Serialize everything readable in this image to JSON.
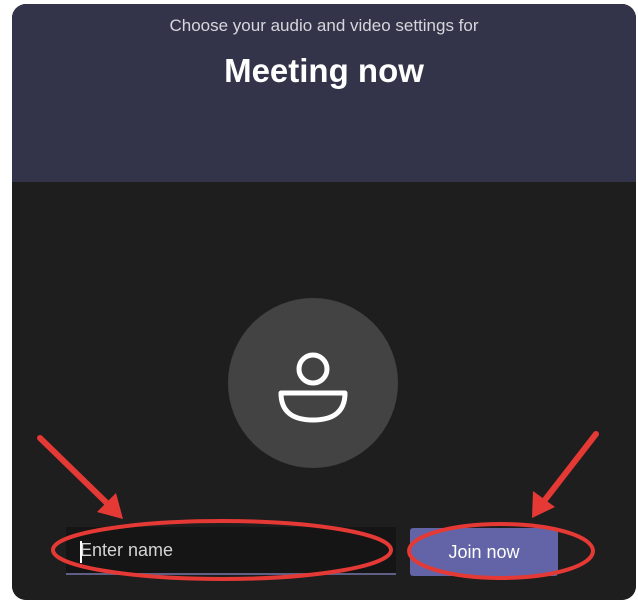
{
  "prejoin": {
    "subtitle": "Choose your audio and video settings for",
    "meeting_title": "Meeting now",
    "avatar_icon": "person-icon",
    "name_input": {
      "value": "",
      "placeholder": "Enter name"
    },
    "join_label": "Join now"
  },
  "colors": {
    "header_bg": "#33344a",
    "preview_bg": "#1f1e1e",
    "accent": "#6264a7",
    "annotation_red": "#e53935"
  },
  "annotations": {
    "arrow_icon": "red-arrow-icon",
    "highlight_icon": "red-ellipse-icon"
  }
}
